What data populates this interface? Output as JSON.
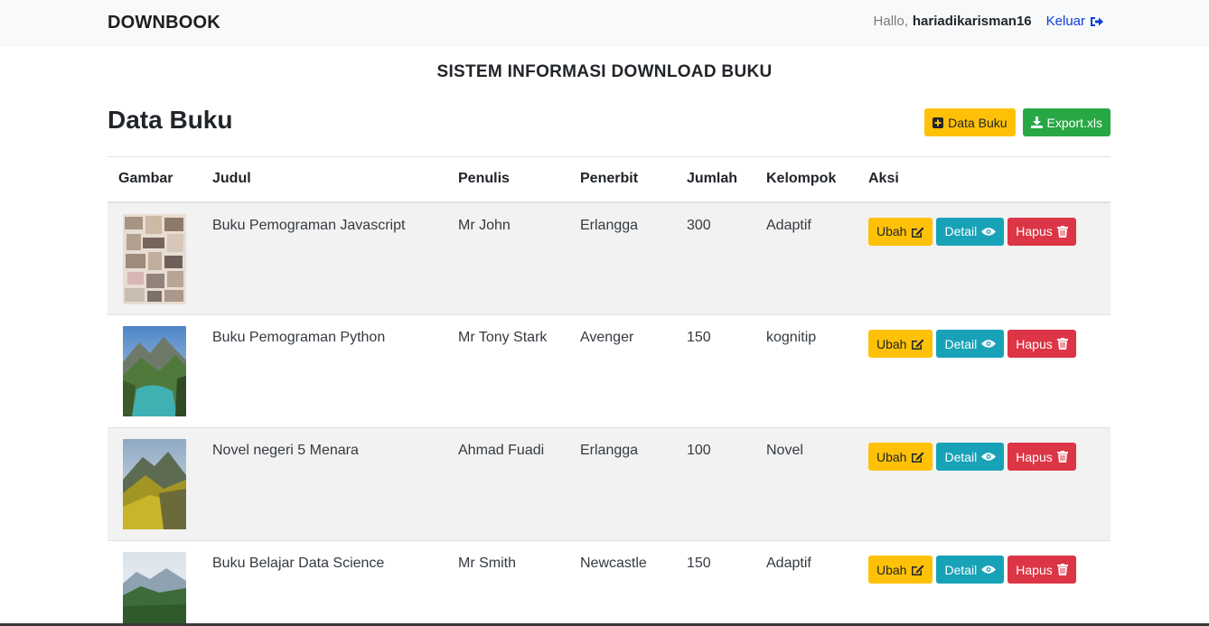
{
  "navbar": {
    "brand": "DOWNBOOK",
    "greeting": "Hallo,",
    "username": "hariadikarisman16",
    "logout_label": "Keluar"
  },
  "system_title": "SISTEM INFORMASI DOWNLOAD BUKU",
  "page_title": "Data Buku",
  "top_actions": {
    "add_label": "Data Buku",
    "export_label": "Export.xls"
  },
  "table": {
    "headers": [
      "Gambar",
      "Judul",
      "Penulis",
      "Penerbit",
      "Jumlah",
      "Kelompok",
      "Aksi"
    ],
    "rows": [
      {
        "title": "Buku Pemograman Javascript",
        "author": "Mr John",
        "publisher": "Erlangga",
        "quantity": "300",
        "group": "Adaptif",
        "image": "collage"
      },
      {
        "title": "Buku Pemograman Python",
        "author": "Mr Tony Stark",
        "publisher": "Avenger",
        "quantity": "150",
        "group": "kognitip",
        "image": "lake-mountain"
      },
      {
        "title": "Novel negeri 5 Menara",
        "author": "Ahmad Fuadi",
        "publisher": "Erlangga",
        "quantity": "100",
        "group": "Novel",
        "image": "yellow-mountain"
      },
      {
        "title": "Buku Belajar Data Science",
        "author": "Mr Smith",
        "publisher": "Newcastle",
        "quantity": "150",
        "group": "Adaptif",
        "image": "forest-lake"
      }
    ],
    "row_actions": {
      "edit_label": "Ubah",
      "detail_label": "Detail",
      "delete_label": "Hapus"
    }
  },
  "colors": {
    "warning": "#ffc107",
    "success": "#28a745",
    "info": "#17a2b8",
    "danger": "#dc3545",
    "link": "#0d3bd6"
  }
}
